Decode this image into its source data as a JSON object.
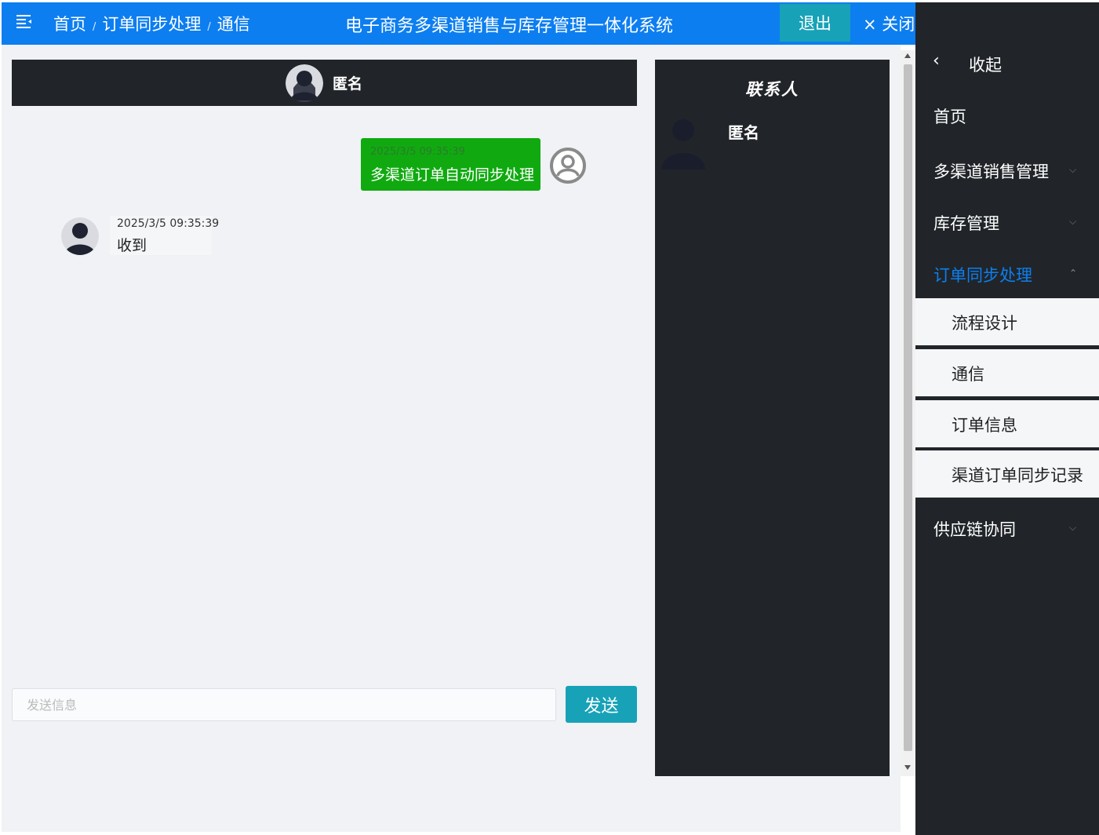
{
  "header": {
    "breadcrumb": [
      "首页",
      "订单同步处理",
      "通信"
    ],
    "separator": "/",
    "title": "电子商务多渠道销售与库存管理一体化系统",
    "logout_label": "退出",
    "close_label": "× 关闭"
  },
  "chat": {
    "partner_name": "匿名",
    "messages": [
      {
        "side": "right",
        "time": "2025/3/5 09:35:39",
        "text": "多渠道订单自动同步处理"
      },
      {
        "side": "left",
        "time": "2025/3/5 09:35:39",
        "text": "收到"
      }
    ],
    "input_placeholder": "发送信息",
    "send_label": "发送"
  },
  "contacts": {
    "title": "联系人",
    "items": [
      {
        "name": "匿名"
      }
    ]
  },
  "sidebar": {
    "collapse_label": "收起",
    "items": [
      {
        "label": "首页"
      },
      {
        "label": "多渠道销售管理"
      },
      {
        "label": "库存管理"
      },
      {
        "label": "订单同步处理"
      },
      {
        "label": "供应链协同"
      }
    ],
    "subitems": [
      {
        "label": "流程设计"
      },
      {
        "label": "通信"
      },
      {
        "label": "订单信息"
      },
      {
        "label": "渠道订单同步记录"
      }
    ]
  },
  "colors": {
    "header_bg": "#0d7ef0",
    "dark_panel": "#212529",
    "sent_bubble": "#10aa10",
    "button_teal": "#17a2b8"
  }
}
